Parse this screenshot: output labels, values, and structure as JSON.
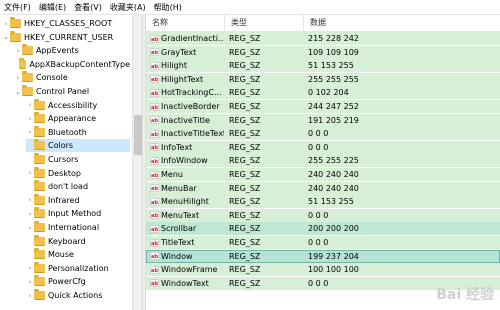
{
  "menu": {
    "items": [
      "文件(F)",
      "编辑(E)",
      "查看(V)",
      "收藏夹(A)",
      "帮助(H)"
    ]
  },
  "tree": {
    "items": [
      {
        "label": "HKEY_CLASSES_ROOT",
        "arrow": "›",
        "level": 0
      },
      {
        "label": "HKEY_CURRENT_USER",
        "arrow": "⌄",
        "level": 0
      },
      {
        "label": "AppEvents",
        "arrow": "›",
        "level": 1
      },
      {
        "label": "AppXBackupContentType",
        "arrow": "",
        "level": 1
      },
      {
        "label": "Console",
        "arrow": "›",
        "level": 1
      },
      {
        "label": "Control Panel",
        "arrow": "⌄",
        "level": 1
      },
      {
        "label": "Accessibility",
        "arrow": "›",
        "level": 2
      },
      {
        "label": "Appearance",
        "arrow": "›",
        "level": 2
      },
      {
        "label": "Bluetooth",
        "arrow": "›",
        "level": 2
      },
      {
        "label": "Colors",
        "arrow": "",
        "level": 2,
        "selected": true
      },
      {
        "label": "Cursors",
        "arrow": "",
        "level": 2
      },
      {
        "label": "Desktop",
        "arrow": "›",
        "level": 2
      },
      {
        "label": "don't load",
        "arrow": "",
        "level": 2
      },
      {
        "label": "Infrared",
        "arrow": "›",
        "level": 2
      },
      {
        "label": "Input Method",
        "arrow": "›",
        "level": 2
      },
      {
        "label": "International",
        "arrow": "›",
        "level": 2
      },
      {
        "label": "Keyboard",
        "arrow": "",
        "level": 2
      },
      {
        "label": "Mouse",
        "arrow": "",
        "level": 2
      },
      {
        "label": "Personalization",
        "arrow": "›",
        "level": 2
      },
      {
        "label": "PowerCfg",
        "arrow": "›",
        "level": 2
      },
      {
        "label": "Quick Actions",
        "arrow": "›",
        "level": 2
      }
    ]
  },
  "list": {
    "headers": {
      "name": "名称",
      "type": "类型",
      "data": "数据"
    },
    "rows": [
      {
        "name": "GradientInacti...",
        "type": "REG_SZ",
        "data": "215 228 242"
      },
      {
        "name": "GrayText",
        "type": "REG_SZ",
        "data": "109 109 109"
      },
      {
        "name": "Hilight",
        "type": "REG_SZ",
        "data": "51 153 255"
      },
      {
        "name": "HilightText",
        "type": "REG_SZ",
        "data": "255 255 255"
      },
      {
        "name": "HotTrackingC...",
        "type": "REG_SZ",
        "data": "0 102 204"
      },
      {
        "name": "InactiveBorder",
        "type": "REG_SZ",
        "data": "244 247 252"
      },
      {
        "name": "InactiveTitle",
        "type": "REG_SZ",
        "data": "191 205 219"
      },
      {
        "name": "InactiveTitleText",
        "type": "REG_SZ",
        "data": "0 0 0"
      },
      {
        "name": "InfoText",
        "type": "REG_SZ",
        "data": "0 0 0"
      },
      {
        "name": "InfoWindow",
        "type": "REG_SZ",
        "data": "255 255 225"
      },
      {
        "name": "Menu",
        "type": "REG_SZ",
        "data": "240 240 240"
      },
      {
        "name": "MenuBar",
        "type": "REG_SZ",
        "data": "240 240 240"
      },
      {
        "name": "MenuHilight",
        "type": "REG_SZ",
        "data": "51 153 255"
      },
      {
        "name": "MenuText",
        "type": "REG_SZ",
        "data": "0 0 0"
      },
      {
        "name": "Scrollbar",
        "type": "REG_SZ",
        "data": "200 200 200",
        "state": "hl"
      },
      {
        "name": "TitleText",
        "type": "REG_SZ",
        "data": "0 0 0"
      },
      {
        "name": "Window",
        "type": "REG_SZ",
        "data": "199 237 204",
        "state": "sel"
      },
      {
        "name": "WindowFrame",
        "type": "REG_SZ",
        "data": "100 100 100"
      },
      {
        "name": "WindowText",
        "type": "REG_SZ",
        "data": "0 0 0"
      }
    ]
  },
  "icons": {
    "folder": "folder-icon",
    "value": "string-value-icon"
  },
  "colors": {
    "list_bg": "#d6efd6",
    "selected_tree": "#cce8ff",
    "folder": "#f0c24c"
  },
  "watermark": "Bai 经验"
}
